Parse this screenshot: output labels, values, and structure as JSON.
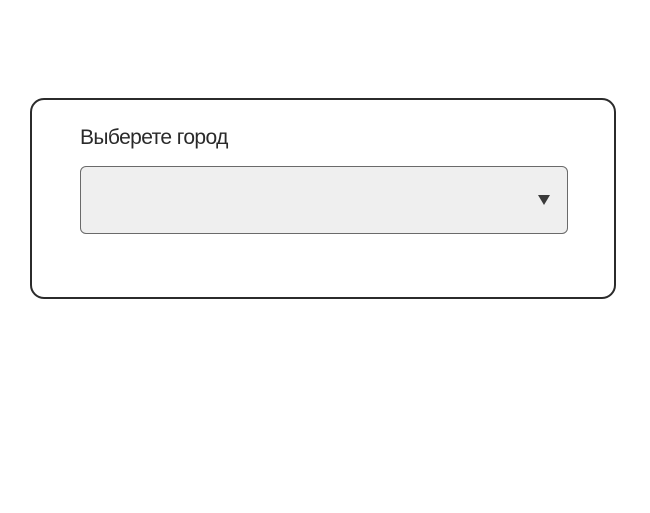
{
  "form": {
    "label": "Выберете город",
    "select": {
      "selected": "",
      "icon": "caret-down-icon"
    }
  }
}
